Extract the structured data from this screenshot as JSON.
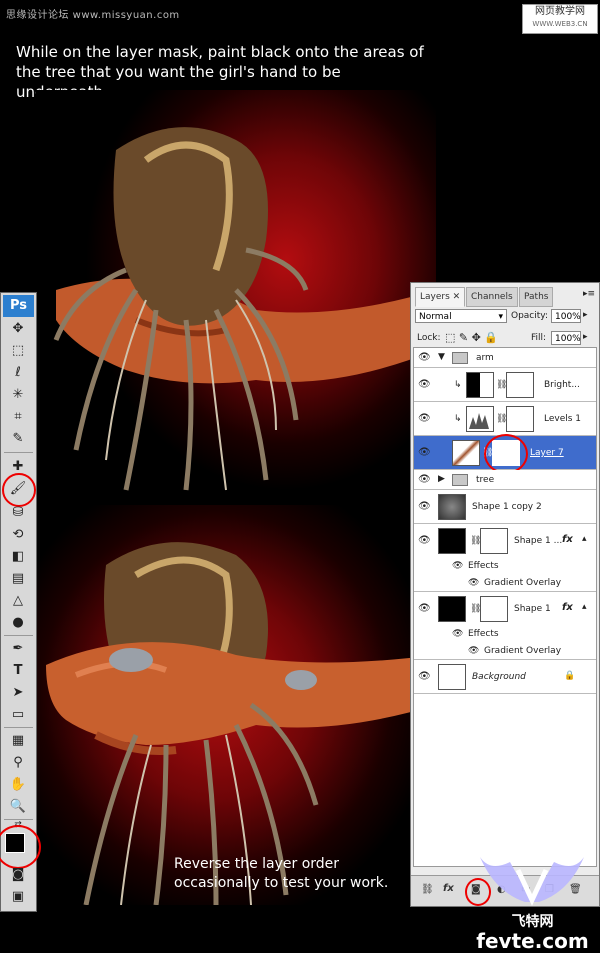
{
  "watermark_top": "思缘设计论坛 www.missyuan.com",
  "watermark_right": {
    "line1": "网页教学网",
    "line2": "WWW.WEB3.CN"
  },
  "caption_top": "While on the layer mask, paint black onto the areas of the tree that you want the girl's hand to be underneath.",
  "caption_bottom": "Reverse the layer order occasionally to test your work.",
  "brand": {
    "line1": "飞特网",
    "line2": "fevte.com"
  },
  "toolbox": {
    "logo": "Ps"
  },
  "layers_panel": {
    "tabs": [
      "Layers",
      "Channels",
      "Paths"
    ],
    "blend_mode": "Normal",
    "opacity_label": "Opacity:",
    "opacity_value": "100%",
    "lock_label": "Lock:",
    "fill_label": "Fill:",
    "fill_value": "100%",
    "layers": [
      {
        "name": "arm"
      },
      {
        "name": "Bright..."
      },
      {
        "name": "Levels 1"
      },
      {
        "name": "Layer 7"
      },
      {
        "name": "tree"
      },
      {
        "name": "Shape 1 copy 2"
      },
      {
        "name": "Shape 1 ..."
      },
      {
        "name": "Effects"
      },
      {
        "name": "Gradient Overlay"
      },
      {
        "name": "Shape 1"
      },
      {
        "name": "Effects"
      },
      {
        "name": "Gradient Overlay"
      },
      {
        "name": "Background"
      }
    ],
    "fx_label": "fx"
  },
  "colors": {
    "accent_selected": "#3f6ccc",
    "highlight_ring": "#e00000",
    "ps_blue": "#2c7fcf"
  }
}
